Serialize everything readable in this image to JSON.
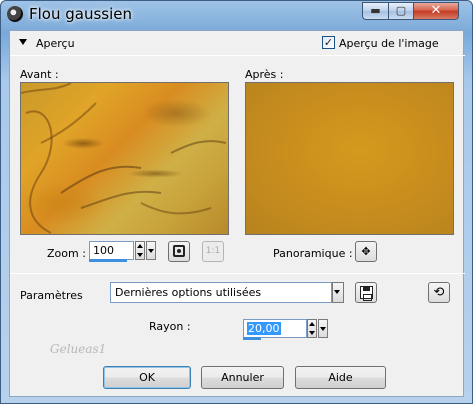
{
  "window": {
    "title": "Flou gaussien",
    "min_glyph": "▬",
    "max_glyph": "▢",
    "close_glyph": "✕"
  },
  "header": {
    "section_label": "Aperçu",
    "preview_checkbox_label": "Aperçu de l'image",
    "preview_checkbox_checked": true,
    "checkbox_glyph": "✓"
  },
  "preview": {
    "before_label": "Avant :",
    "after_label": "Après :"
  },
  "zoom": {
    "label": "Zoom :",
    "value": "100",
    "fit_button_icon": "fit-window-icon",
    "actual_size_button_glyph": "1:1"
  },
  "pan": {
    "label": "Panoramique :",
    "button_glyph": "✥"
  },
  "params": {
    "label": "Paramètres",
    "preset_value": "Dernières options utilisées",
    "save_icon": "floppy-disk-icon",
    "reset_icon": "reset-icon",
    "reset_glyph": "⟲"
  },
  "rayon": {
    "label": "Rayon :",
    "value": "20,00"
  },
  "watermark": "Gelueas1",
  "buttons": {
    "ok": "OK",
    "cancel": "Annuler",
    "help": "Aide"
  },
  "colors": {
    "title_bar": "#9fc3e6",
    "close_button": "#c23a22",
    "selection": "#3399ff",
    "preview_blur": "#cc8f1d"
  }
}
